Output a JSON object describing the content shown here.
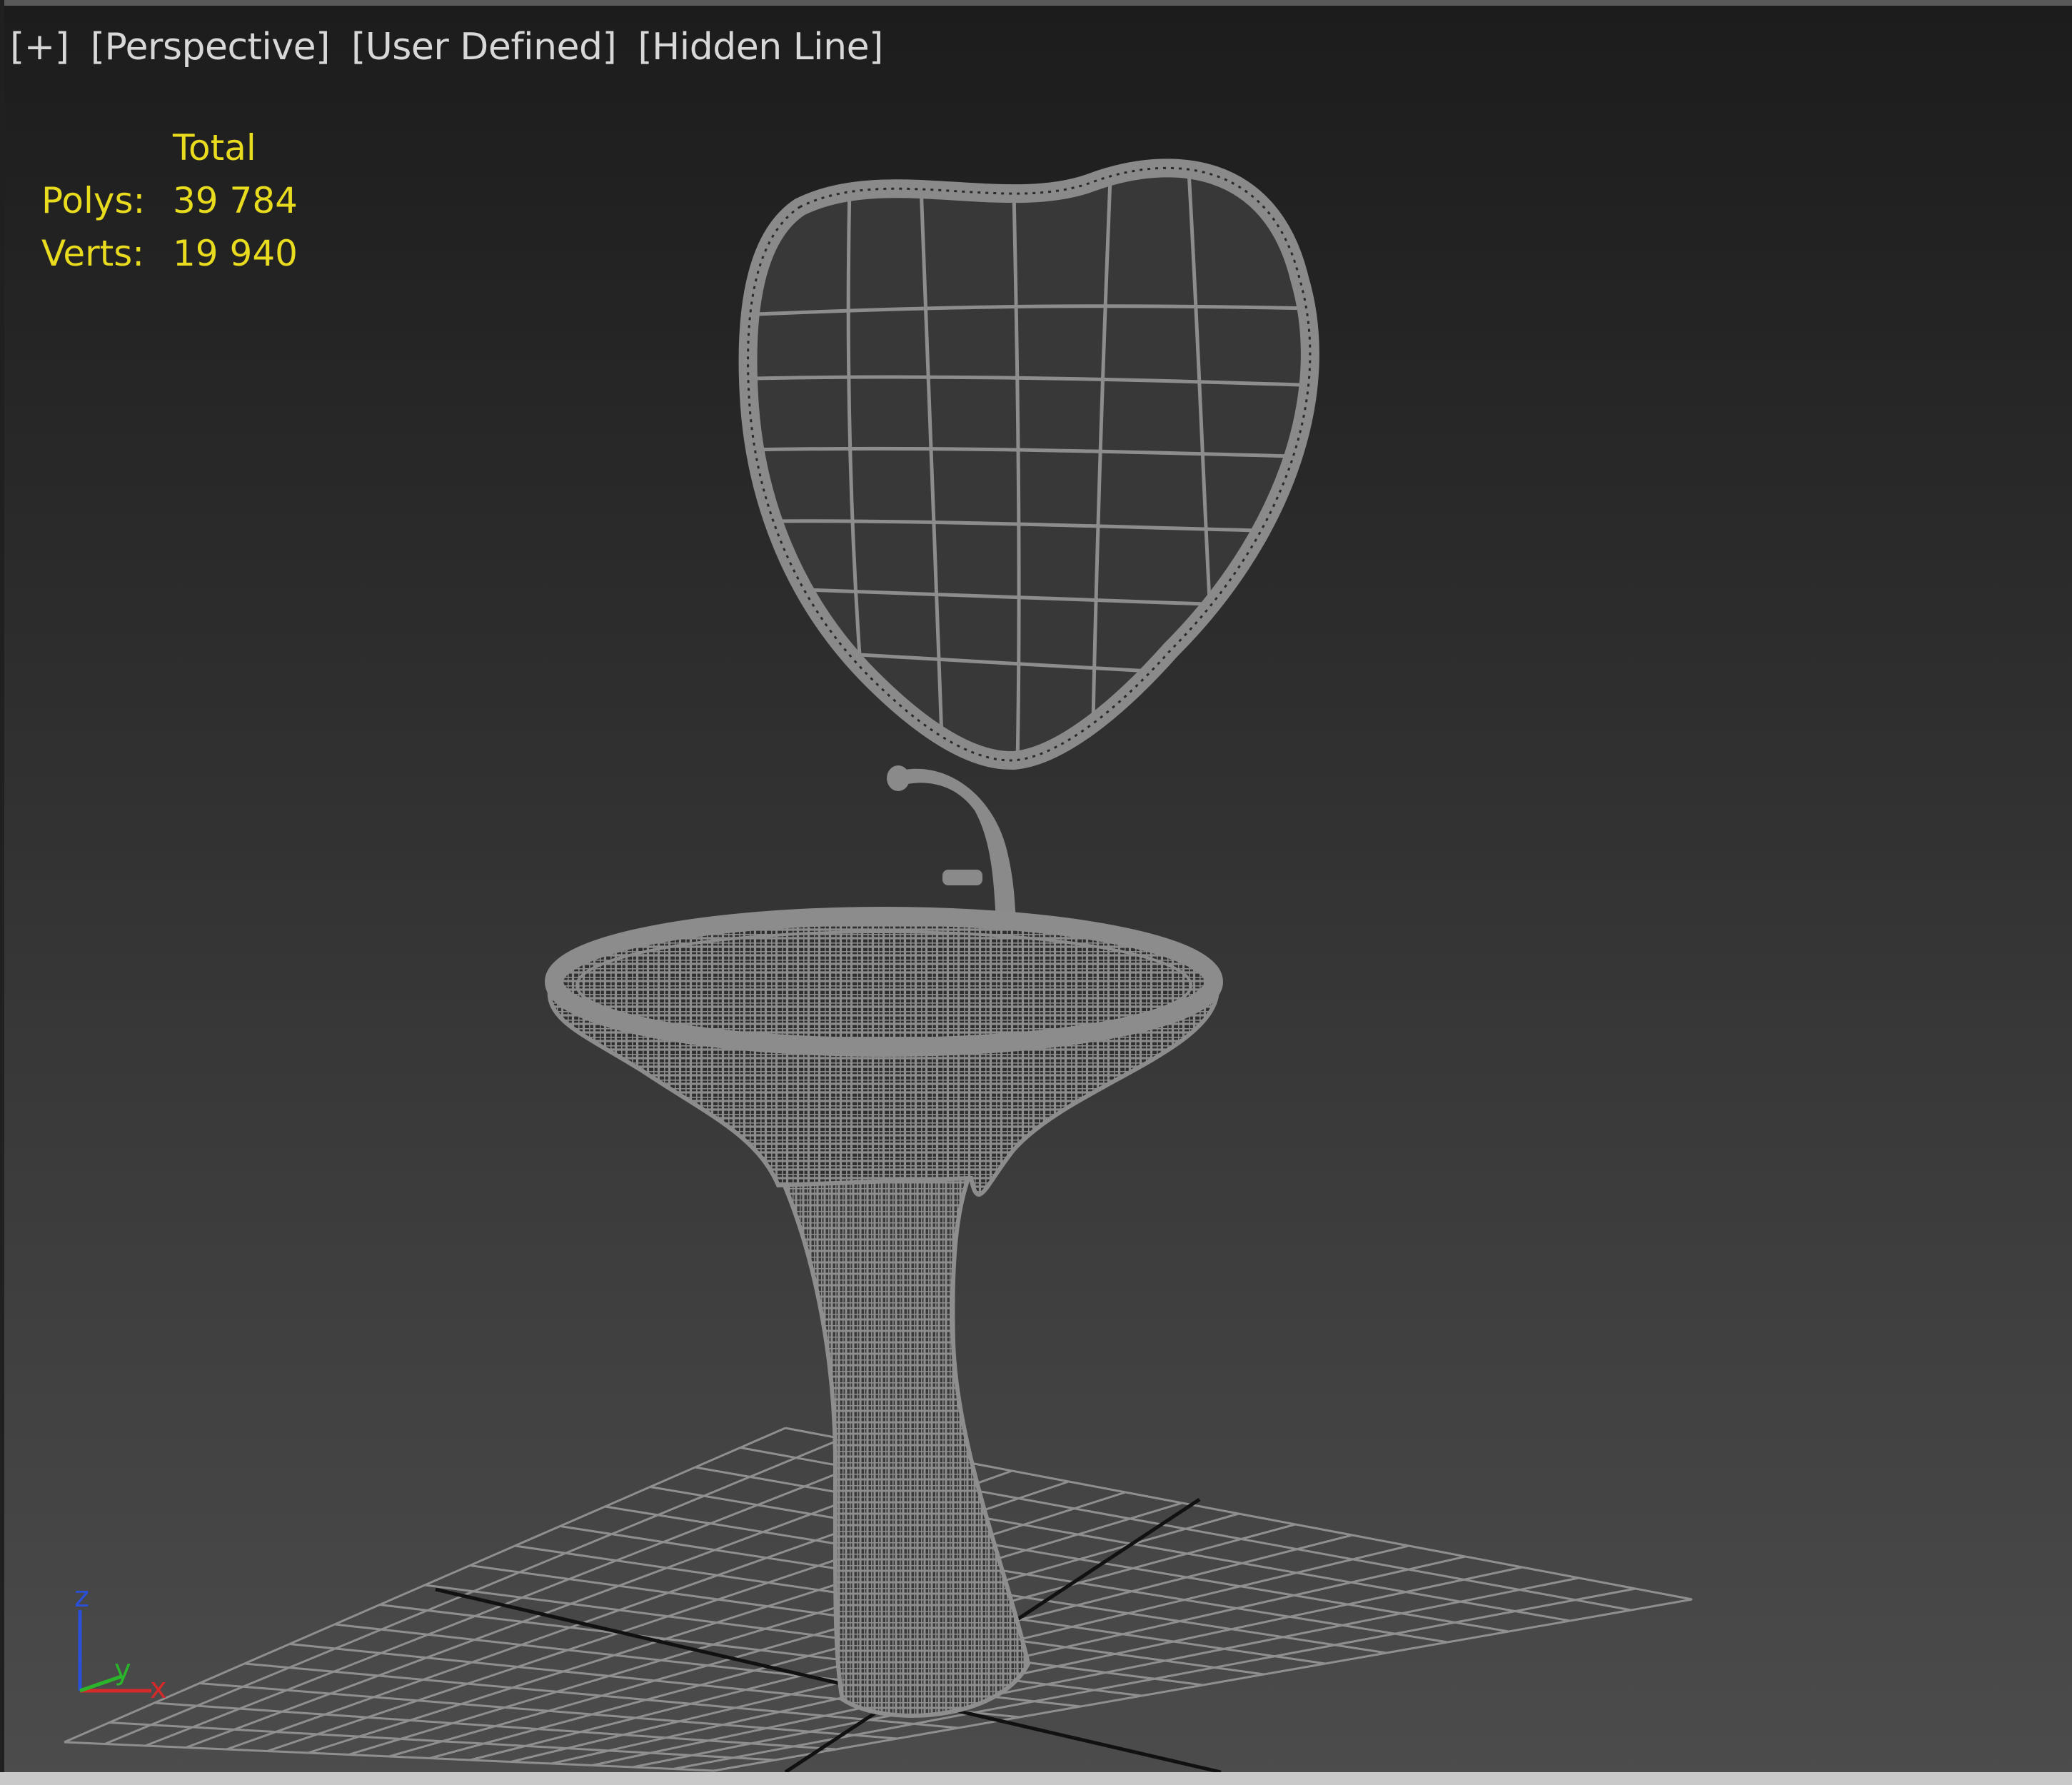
{
  "viewport": {
    "labels": [
      "[+]",
      "[Perspective]",
      "[User Defined]",
      "[Hidden Line]"
    ]
  },
  "stats": {
    "header": "Total",
    "polys_label": "Polys:",
    "polys_value": "39 784",
    "verts_label": "Verts:",
    "verts_value": "19 940"
  },
  "gizmo": {
    "z": "z",
    "y": "y",
    "x": "x"
  },
  "colors": {
    "stats_text": "#e9dc1f",
    "label_text": "#d8d8d8",
    "wireframe": "#8a8a8a",
    "grid": "#8f8f8f",
    "grid_axis": "#111111",
    "axis_x": "#d42a2a",
    "axis_y": "#2bb52b",
    "axis_z": "#2a4fd8"
  }
}
